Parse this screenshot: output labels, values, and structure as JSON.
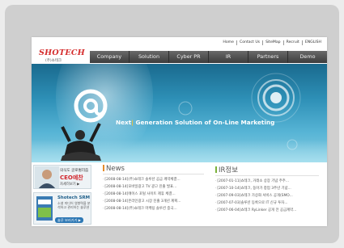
{
  "top_links": [
    "Home",
    "Contact Us",
    "SiteMap",
    "Recruit",
    "ENGLISH"
  ],
  "logo": {
    "name": "SHOTECH",
    "sub": "(주)쇼테크"
  },
  "nav": [
    "Company",
    "Solution",
    "Cyber PR",
    "IR",
    "Partners",
    "Demo"
  ],
  "hero": {
    "tagline_prefix": "Next",
    "tagline_accent": "|",
    "tagline_rest": " Generation Solution of On-Line Marketing"
  },
  "sidebar": {
    "ceo_top": "의식도 글로벌리즘",
    "ceo_title": "CEO예찬",
    "ceo_more": "자세히보기 ▶",
    "srm_title": "Shotech SRM",
    "srm_desc": "소셜 미디어 영향력을 분석하고 관리하는 솔루션",
    "srm_btn": "솔루 보러가기 ▶"
  },
  "news": {
    "title": "News",
    "items": [
      "[2008-08-14](주)쇼테크 솔루션 공급 계약체결...",
      "[2008-08-14]모바일광고 TV 광고 진출 발표...",
      "[2008-08-14]에이스 포털 사이트 제휴 체결...",
      "[2008-08-14]온라인광고 시장 진출 3개년 계획...",
      "[2008-08-14](주)쇼테크 마케팅 솔루션 중국..."
    ],
    "more": "more"
  },
  "ir": {
    "title": "IR정보",
    "items": [
      "[2007-01-11]쇼테크, 거래소 상장 기념 주주...",
      "[2007-10-14]쇼테크, 동아가 창업 3주년 기념...",
      "[2007-09-03]쇼테크 가상화 서비스 공개(SMO...",
      "[2007-07-03]솔루션 등록으로 IT 신규 투자...",
      "[2007-06-04]쇼테크 RyLinker 공개 전 공급계약..."
    ],
    "more": "more"
  },
  "colors": {
    "brand_red": "#d42a2a",
    "nav_bg": "#4a4a4a",
    "hero_blue": "#2d8fb6",
    "accent_yellow": "#f6c22d"
  }
}
